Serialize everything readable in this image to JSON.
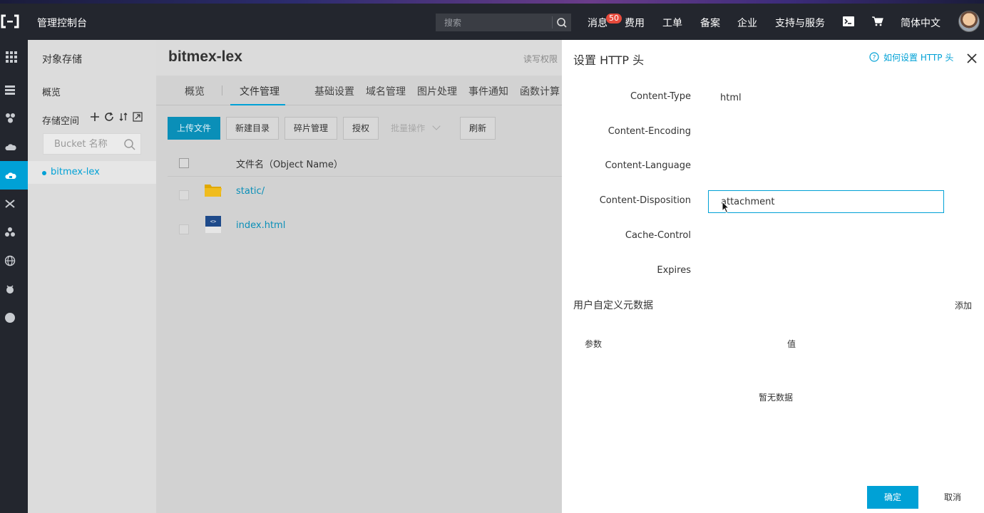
{
  "topbar": {
    "console_title": "管理控制台",
    "search_placeholder": "搜索",
    "nav": {
      "messages": "消息",
      "messages_badge": "50",
      "billing": "费用",
      "tickets": "工单",
      "icp": "备案",
      "enterprise": "企业",
      "support": "支持与服务",
      "language": "简体中文"
    }
  },
  "rail": {
    "icons": [
      "grid-icon",
      "server-icon",
      "network-icon",
      "cloud-icon",
      "oss-icon",
      "shuffle-icon",
      "cluster-icon",
      "globe-icon",
      "bug-icon",
      "circle-icon"
    ]
  },
  "sidebar": {
    "title": "对象存储",
    "overview": "概览",
    "bucket_space": "存储空间",
    "bucket_search_placeholder": "Bucket 名称",
    "bucket_name": "bitmex-lex"
  },
  "main": {
    "bucket_title": "bitmex-lex",
    "permission": "读写权限",
    "tabs": [
      "概览",
      "文件管理",
      "基础设置",
      "域名管理",
      "图片处理",
      "事件通知",
      "函数计算"
    ],
    "buttons": {
      "upload": "上传文件",
      "new_dir": "新建目录",
      "fragments": "碎片管理",
      "authorize": "授权",
      "batch": "批量操作",
      "refresh": "刷新"
    },
    "table": {
      "col_name": "文件名（Object Name）",
      "rows": [
        {
          "name": "static/",
          "type": "folder"
        },
        {
          "name": "index.html",
          "type": "html"
        }
      ]
    }
  },
  "panel": {
    "title": "设置 HTTP 头",
    "help_link": "如何设置 HTTP 头",
    "fields": {
      "content_type_label": "Content-Type",
      "content_type_value": "html",
      "content_encoding_label": "Content-Encoding",
      "content_language_label": "Content-Language",
      "content_disposition_label": "Content-Disposition",
      "content_disposition_value": "attachment",
      "cache_control_label": "Cache-Control",
      "expires_label": "Expires"
    },
    "metadata": {
      "section_title": "用户自定义元数据",
      "add": "添加",
      "col_param": "参数",
      "col_value": "值",
      "empty": "暂无数据"
    },
    "ok": "确定",
    "cancel": "取消"
  },
  "colors": {
    "accent": "#00a1d6",
    "topbar_bg": "#23262e",
    "badge": "#e64a3c"
  }
}
